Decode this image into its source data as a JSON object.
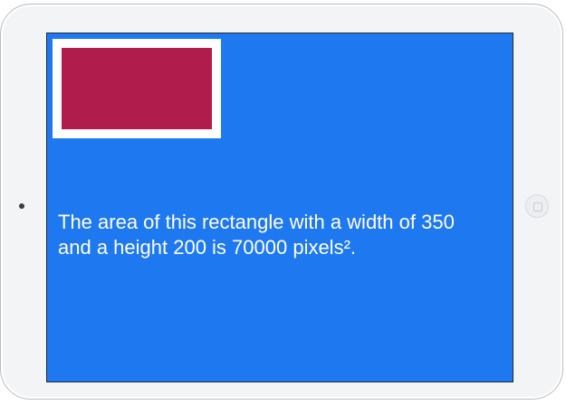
{
  "app": {
    "area_message": "The area of this rectangle with a width of 350 and a height 200 is 70000 pixels².",
    "screen_background_color": "#1e78f0",
    "rectangle_fill_color": "#b01c4c",
    "rectangle_border_color": "#ffffff",
    "text_color": "#ffffff"
  },
  "device": {
    "camera_icon": "camera-icon",
    "home_button_icon": "home-button-icon"
  }
}
